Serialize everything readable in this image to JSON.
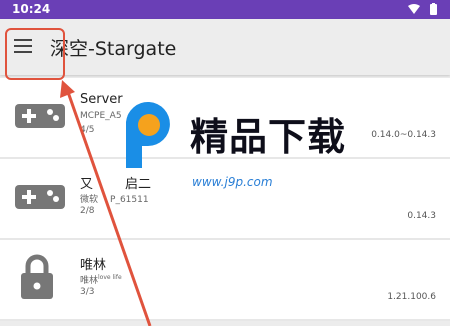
{
  "status": {
    "time": "10:24"
  },
  "app_bar": {
    "title": "深空-Stargate"
  },
  "servers": [
    {
      "name": "Server",
      "subtitle": "MCPE_A5",
      "count": "4/5",
      "version": "0.14.0~0.14.3",
      "icon": "gamepad-icon"
    },
    {
      "name": "又",
      "name_tail": "启二",
      "subtitle": "微软",
      "subtitle_tail": "P_61511",
      "count": "2/8",
      "version": "0.14.3",
      "icon": "gamepad-icon"
    },
    {
      "name": "唯林",
      "subtitle": "唯林",
      "subtitle_sup": "love life",
      "count": "3/3",
      "version": "1.21.100.6",
      "icon": "lock-icon"
    }
  ],
  "watermark": {
    "text": "精品下载",
    "url": "www.j9p.com"
  },
  "colors": {
    "status_bar": "#6a3fb6",
    "annotation": "#e0533d"
  }
}
